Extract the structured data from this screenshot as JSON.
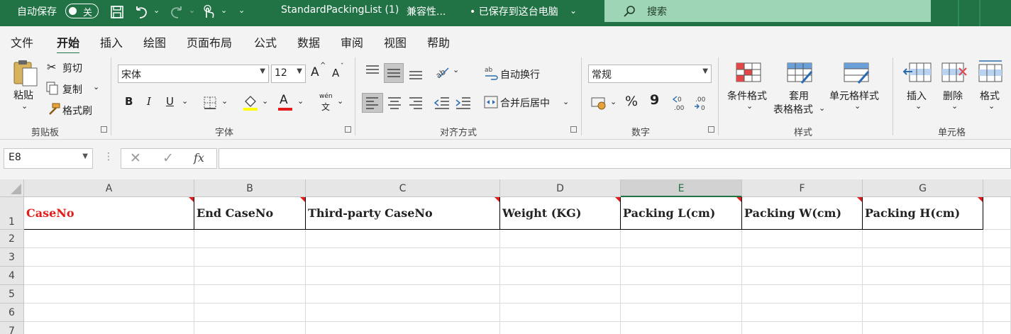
{
  "titlebar": {
    "autosave_label": "自动保存",
    "autosave_state": "关",
    "filename": "StandardPackingList (1)",
    "compat": "兼容性...",
    "save_status": "• 已保存到这台电脑",
    "search_label": "搜索"
  },
  "tabs": [
    "文件",
    "开始",
    "插入",
    "绘图",
    "页面布局",
    "公式",
    "数据",
    "审阅",
    "视图",
    "帮助"
  ],
  "ribbon": {
    "clipboard": {
      "paste": "粘贴",
      "cut": "剪切",
      "copy": "复制",
      "format_painter": "格式刷",
      "group": "剪贴板"
    },
    "font": {
      "name": "宋体",
      "size": "12",
      "grow": "A",
      "shrink": "A",
      "bold": "B",
      "italic": "I",
      "underline": "U",
      "color_a": "A",
      "phonetic": "wén",
      "phonetic_char": "文",
      "group": "字体"
    },
    "alignment": {
      "wrap": "自动换行",
      "merge": "合并后居中",
      "group": "对齐方式"
    },
    "number": {
      "format": "常规",
      "percent": "%",
      "comma": "9",
      "group": "数字"
    },
    "styles": {
      "conditional": "条件格式",
      "table_line1": "套用",
      "table_line2": "表格格式",
      "cell_styles": "单元格样式",
      "group": "样式"
    },
    "cells": {
      "insert": "插入",
      "delete": "删除",
      "format": "格式",
      "group": "单元格"
    }
  },
  "formula_bar": {
    "name_box": "E8",
    "fx": "fx",
    "value": ""
  },
  "sheet": {
    "columns": [
      "A",
      "B",
      "C",
      "D",
      "E",
      "F",
      "G"
    ],
    "rows": [
      "1",
      "2",
      "3",
      "4",
      "5",
      "6",
      "7"
    ],
    "header_cells": [
      "CaseNo",
      "End CaseNo",
      "Third-party CaseNo",
      "Weight (KG)",
      "Packing L(cm)",
      "Packing W(cm)",
      "Packing H(cm)"
    ],
    "selected_column": "E"
  },
  "colors": {
    "brand": "#217346",
    "search_bg": "#9fd5b7",
    "comment_marker": "#e31b1b",
    "caseno_text": "#e31b1b"
  }
}
